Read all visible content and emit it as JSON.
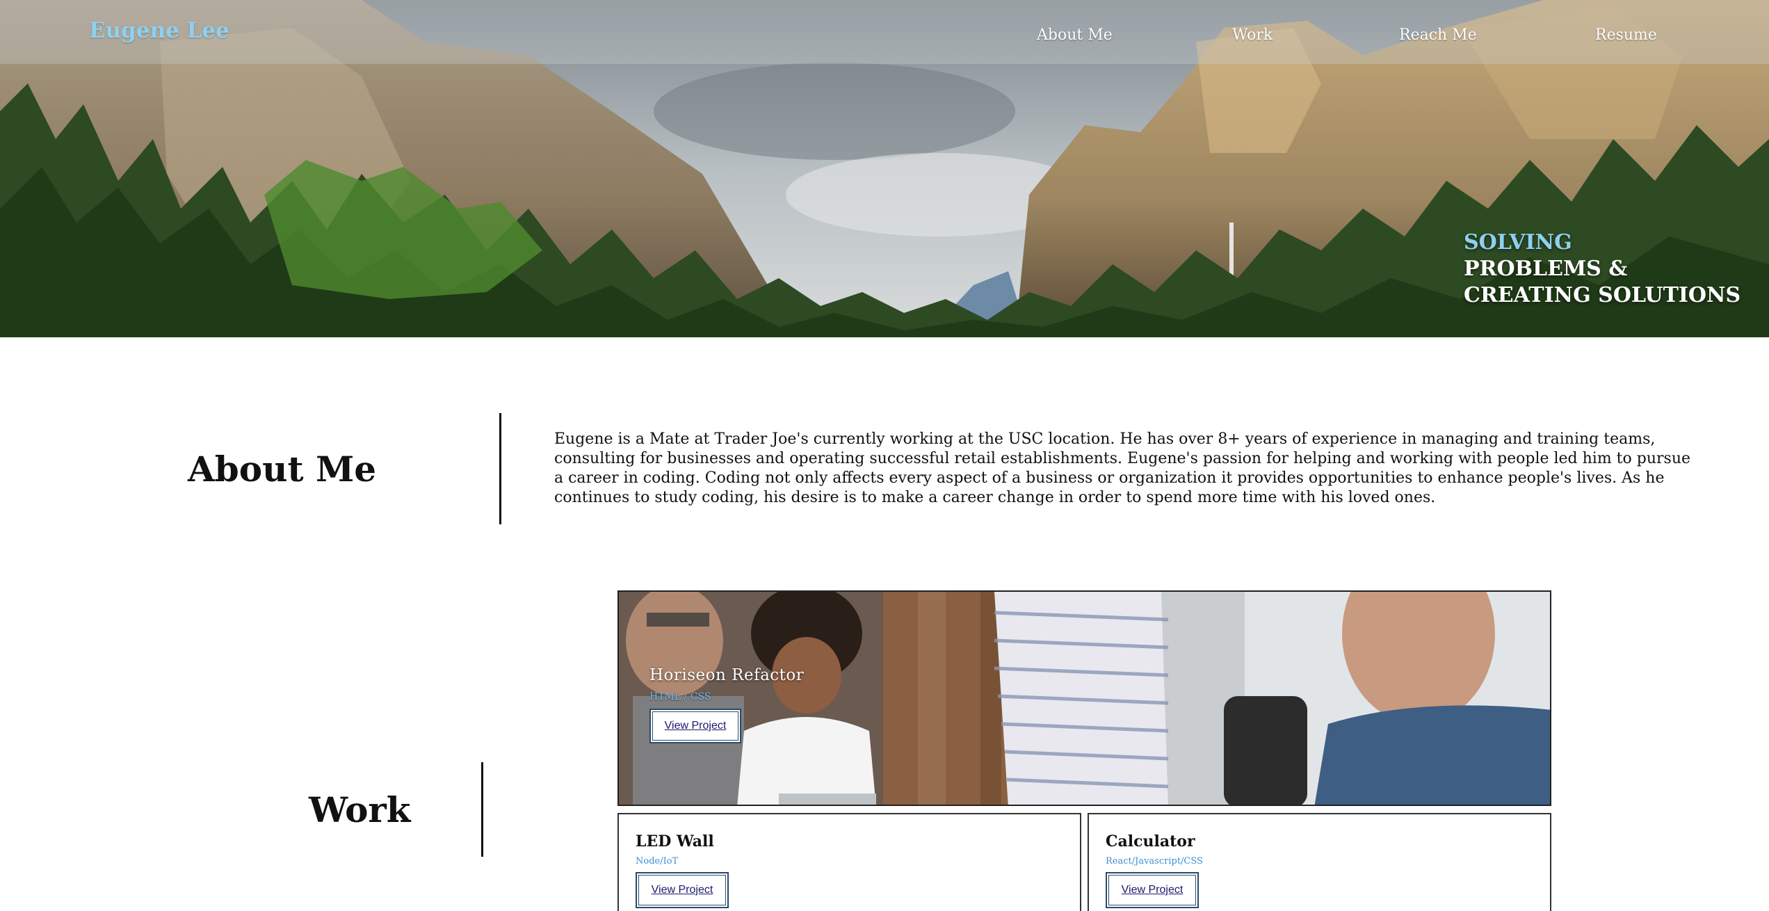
{
  "header": {
    "brand": "Eugene Lee",
    "nav": [
      {
        "label": "About Me"
      },
      {
        "label": "Work"
      },
      {
        "label": "Reach Me"
      },
      {
        "label": "Resume"
      }
    ]
  },
  "hero": {
    "tagline_accent": "SOLVING",
    "tagline_rest": "PROBLEMS & CREATING SOLUTIONS"
  },
  "about": {
    "title": "About Me",
    "body": "Eugene is a Mate at Trader Joe's currently working at the USC location. He has over 8+ years of experience in managing and training teams, consulting for businesses and operating successful retail establishments. Eugene's passion for helping and working with people led him to pursue a career in coding. Coding not only affects every aspect of a business or organization it provides opportunities to enhance people's lives. As he continues to study coding, his desire is to make a career change in order to spend more time with his loved ones."
  },
  "work": {
    "title": "Work",
    "featured": {
      "title": "Horiseon Refactor",
      "tech": "HTML / CSS",
      "button": "View Project"
    },
    "projects": [
      {
        "title": "LED Wall",
        "tech": "Node/IoT",
        "button": "View Project"
      },
      {
        "title": "Calculator",
        "tech": "React/Javascript/CSS",
        "button": "View Project"
      }
    ]
  },
  "colors": {
    "accent": "#8fd0f0",
    "card_border": "#333333",
    "button_border": "#2a4a6a"
  }
}
